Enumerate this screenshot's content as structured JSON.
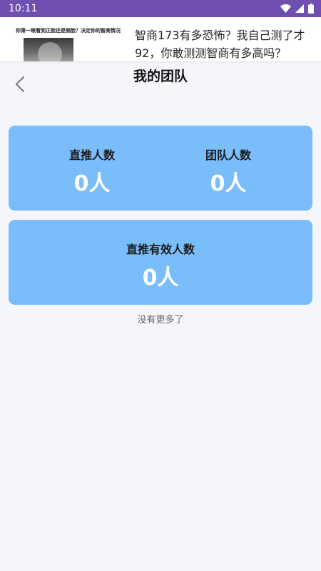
{
  "status_bar": {
    "time": "10:11"
  },
  "ad": {
    "thumb_caption": "你第一眼看到正脸还是侧脸？决定你的智商情况",
    "text": "智商173有多恐怖？我自己测了才92，你敢测测智商有多高吗？"
  },
  "header": {
    "title": "我的团队"
  },
  "cards": {
    "direct": {
      "label": "直推人数",
      "value": "0人"
    },
    "team": {
      "label": "团队人数",
      "value": "0人"
    },
    "valid": {
      "label": "直推有效人数",
      "value": "0人"
    }
  },
  "footer": {
    "note": "没有更多了"
  },
  "colors": {
    "status_bar": "#6f4fb0",
    "card": "#79bdfa",
    "background": "#f5f6fb"
  }
}
